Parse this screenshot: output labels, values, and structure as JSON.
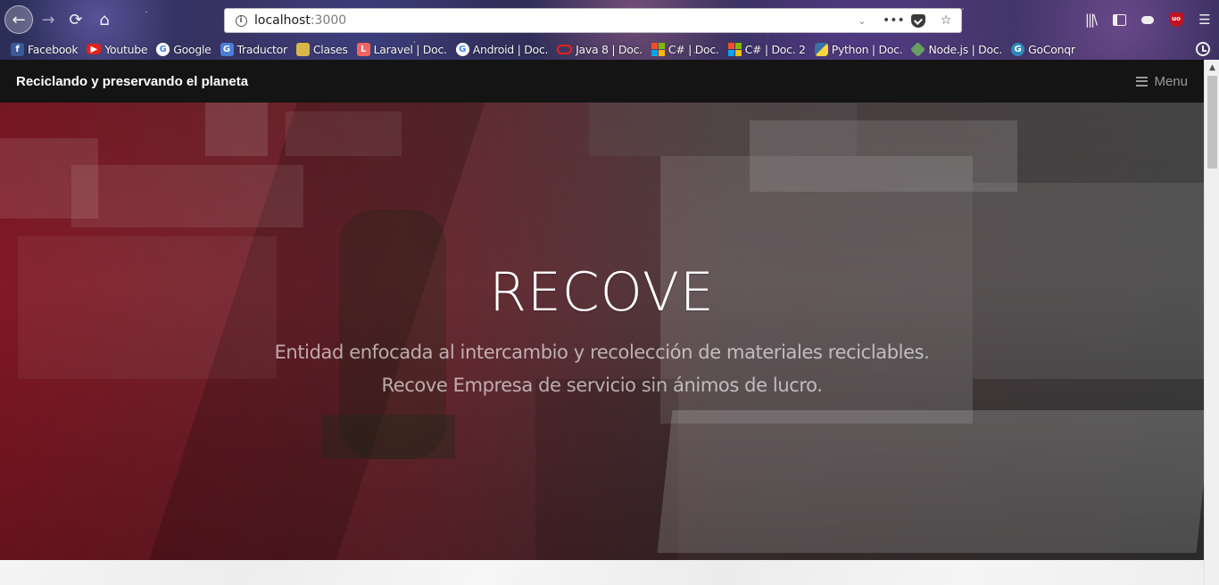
{
  "browser": {
    "url_host": "localhost",
    "url_port": ":3000",
    "bookmarks": [
      {
        "label": "Facebook",
        "icon": "facebook-icon"
      },
      {
        "label": "Youtube",
        "icon": "youtube-icon"
      },
      {
        "label": "Google",
        "icon": "google-icon"
      },
      {
        "label": "Traductor",
        "icon": "google-translate-icon"
      },
      {
        "label": "Clases",
        "icon": "classroom-icon"
      },
      {
        "label": "Laravel | Doc.",
        "icon": "laravel-icon"
      },
      {
        "label": "Android | Doc.",
        "icon": "google-icon"
      },
      {
        "label": "Java 8 | Doc.",
        "icon": "oracle-icon"
      },
      {
        "label": "C# | Doc.",
        "icon": "microsoft-icon"
      },
      {
        "label": "C# | Doc. 2",
        "icon": "microsoft-icon"
      },
      {
        "label": "Python | Doc.",
        "icon": "python-icon"
      },
      {
        "label": "Node.js | Doc.",
        "icon": "nodejs-icon"
      },
      {
        "label": "GoConqr",
        "icon": "goconqr-icon"
      }
    ]
  },
  "site": {
    "brand": "Reciclando y preservando el planeta",
    "menu_label": "Menu"
  },
  "hero": {
    "title": "RECOVE",
    "line1": "Entidad enfocada al intercambio y recolección de materiales reciclables.",
    "line2": "Recove Empresa de servicio sin ánimos de lucro."
  },
  "colors": {
    "nav_background": "#141414",
    "hero_overlay_red": "#8c1423",
    "menu_text": "#9a9a9a"
  }
}
